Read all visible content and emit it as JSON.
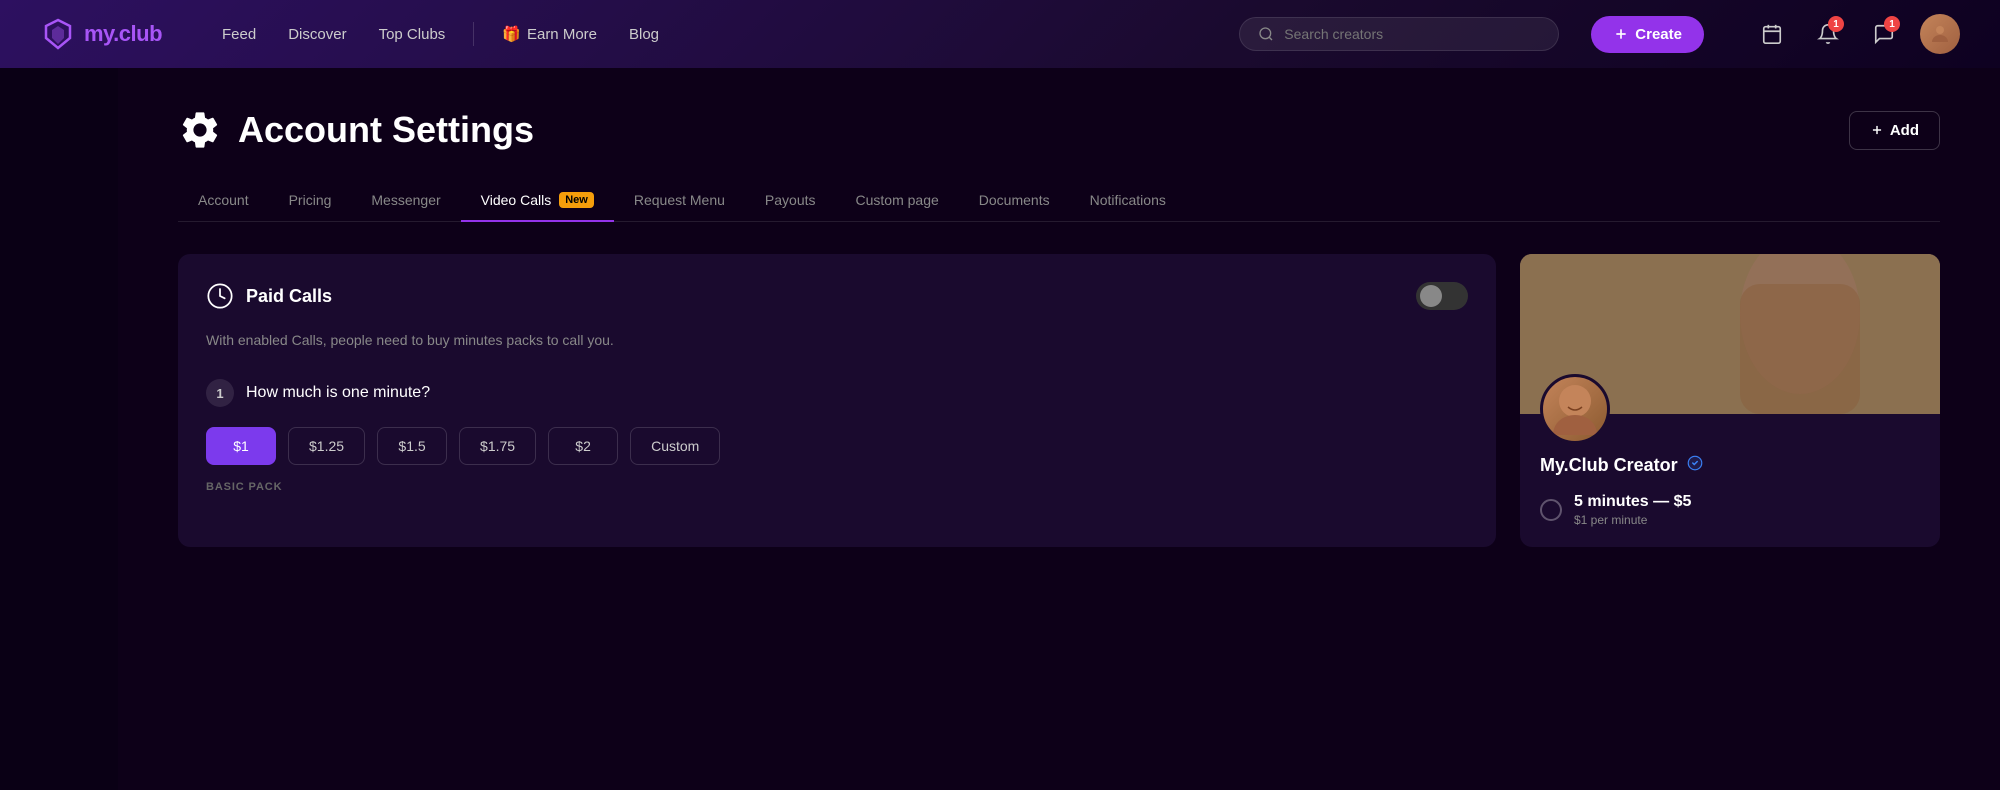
{
  "navbar": {
    "logo_text": "my.club",
    "nav_links": [
      {
        "id": "feed",
        "label": "Feed"
      },
      {
        "id": "discover",
        "label": "Discover"
      },
      {
        "id": "top-clubs",
        "label": "Top Clubs"
      }
    ],
    "earn_more_label": "Earn More",
    "blog_label": "Blog",
    "search_placeholder": "Search creators",
    "create_label": "Create",
    "notification_badge": "1",
    "message_badge": "1"
  },
  "page": {
    "title": "Account Settings",
    "add_btn_label": "Add"
  },
  "tabs": [
    {
      "id": "account",
      "label": "Account",
      "active": false
    },
    {
      "id": "pricing",
      "label": "Pricing",
      "active": false
    },
    {
      "id": "messenger",
      "label": "Messenger",
      "active": false
    },
    {
      "id": "video-calls",
      "label": "Video Calls",
      "active": true,
      "badge": "New"
    },
    {
      "id": "request-menu",
      "label": "Request Menu",
      "active": false
    },
    {
      "id": "payouts",
      "label": "Payouts",
      "active": false
    },
    {
      "id": "custom-page",
      "label": "Custom page",
      "active": false
    },
    {
      "id": "documents",
      "label": "Documents",
      "active": false
    },
    {
      "id": "notifications",
      "label": "Notifications",
      "active": false
    }
  ],
  "paid_calls": {
    "title": "Paid Calls",
    "description": "With enabled Calls, people need to buy minutes packs to call you.",
    "question_number": "1",
    "question": "How much is one minute?",
    "price_options": [
      {
        "id": "p1",
        "label": "$1",
        "selected": true
      },
      {
        "id": "p125",
        "label": "$1.25",
        "selected": false
      },
      {
        "id": "p15",
        "label": "$1.5",
        "selected": false
      },
      {
        "id": "p175",
        "label": "$1.75",
        "selected": false
      },
      {
        "id": "p2",
        "label": "$2",
        "selected": false
      },
      {
        "id": "custom",
        "label": "Custom",
        "selected": false
      }
    ],
    "basic_pack_label": "BASIC PACK"
  },
  "preview": {
    "creator_name": "My.Club Creator",
    "verified": true,
    "minutes_text": "5 minutes — $5",
    "minutes_sub": "$1  per minute"
  }
}
